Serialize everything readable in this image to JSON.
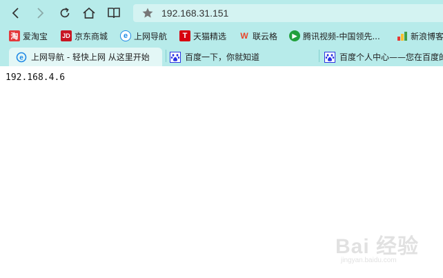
{
  "address_bar": {
    "url": "192.168.31.151"
  },
  "bookmarks": [
    {
      "label": "爱淘宝",
      "icon": "taobao-icon",
      "glyph": "淘",
      "color": "#e4393c"
    },
    {
      "label": "京东商城",
      "icon": "jd-icon",
      "glyph": "JD",
      "color": "#c81623"
    },
    {
      "label": "上网导航",
      "icon": "ie-e-icon",
      "glyph": "e",
      "color": "#1e88e5"
    },
    {
      "label": "天猫精选",
      "icon": "tmall-icon",
      "glyph": "T",
      "color": "#d7000f"
    },
    {
      "label": "联云格",
      "icon": "lianyunge-icon",
      "glyph": "W",
      "color": "#e8462b"
    },
    {
      "label": "腾讯视频-中国领先...",
      "icon": "tencent-video-icon",
      "glyph": "▶",
      "color": "#22a03c"
    },
    {
      "label": "新浪博客",
      "icon": "sina-blog-icon",
      "glyph": "",
      "color": "#f5a623"
    }
  ],
  "tabs": [
    {
      "label": "上网导航 - 轻快上网 从这里开始",
      "icon": "ie-e-icon",
      "active": true
    },
    {
      "label": "百度一下，你就知道",
      "icon": "baidu-paw-icon",
      "active": false
    },
    {
      "label": "百度个人中心——您在百度的",
      "icon": "baidu-paw-icon",
      "active": false
    }
  ],
  "page": {
    "text": "192.168.4.6"
  },
  "watermark": {
    "brand": "Bai 经验",
    "sub": "jingyan.baidu.com"
  }
}
